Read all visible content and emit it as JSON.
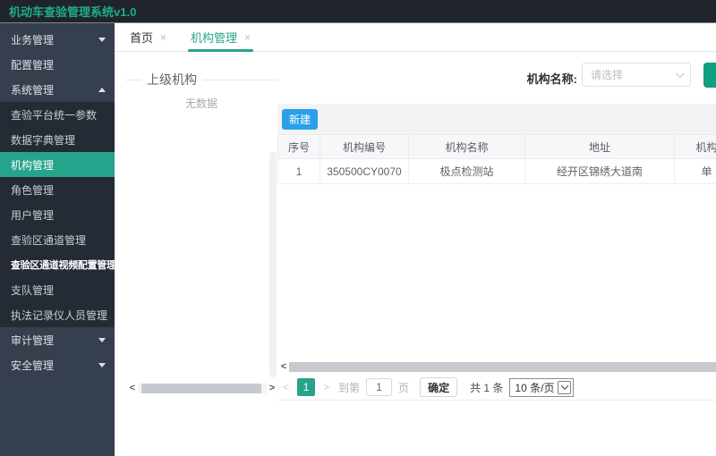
{
  "app": {
    "title": "机动车查验管理系统v1.0"
  },
  "colors": {
    "accent_teal": "#26a48b",
    "title_green": "#1fae83",
    "tab_active_green": "#26a689",
    "new_button_blue": "#2aa1e8",
    "search_button_green": "#0fa07d",
    "sidebar_bg": "#363f4d",
    "submenu_bg": "#242b35",
    "header_bg": "#1f242b"
  },
  "icons": {
    "close": "×",
    "scroll_left": "<",
    "scroll_right": ">"
  },
  "sidebar": {
    "items_top": [
      "业务管理",
      "配置管理",
      "系统管理"
    ],
    "submenu": [
      "查验平台统一参数",
      "数据字典管理",
      "机构管理",
      "角色管理",
      "用户管理",
      "查验区通道管理",
      "查验区通道视频配置管理",
      "支队管理",
      "执法记录仪人员管理"
    ],
    "selected_item": "机构管理",
    "items_bottom": [
      "审计管理",
      "安全管理"
    ]
  },
  "tabs": {
    "home": "首页",
    "org": "机构管理"
  },
  "tree_panel": {
    "title": "上级机构",
    "empty_text": "无数据"
  },
  "filter": {
    "label": "机构名称:",
    "placeholder": "请选择"
  },
  "toolbar": {
    "new_button": "新建"
  },
  "table": {
    "columns": [
      "序号",
      "机构编号",
      "机构名称",
      "地址",
      "机构"
    ],
    "rows": [
      [
        "1",
        "350500CY0070",
        "极点检测站",
        "经开区锦绣大道南",
        "单"
      ]
    ]
  },
  "pagination": {
    "prev": "<",
    "page": "1",
    "next": ">",
    "goto_prefix": "到第",
    "goto_value": "1",
    "goto_suffix": "页",
    "confirm": "确定",
    "total": "共 1 条",
    "page_size": "10 条/页"
  }
}
